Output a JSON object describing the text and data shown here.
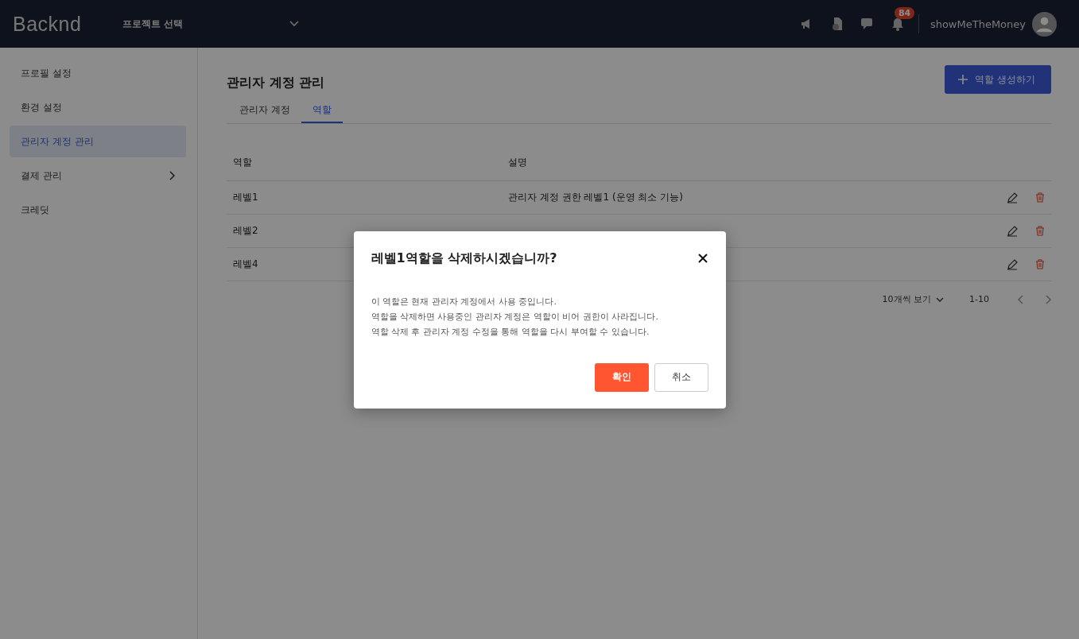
{
  "header": {
    "logo": "Backnd",
    "project_select": {
      "label": "프로젝트 선택"
    },
    "notification_count": "84",
    "username": "showMeTheMoney"
  },
  "sidebar": {
    "items": [
      {
        "label": "프로필 설정",
        "selected": false,
        "expandable": false
      },
      {
        "label": "환경 설정",
        "selected": false,
        "expandable": false
      },
      {
        "label": "관리자 계정 관리",
        "selected": true,
        "expandable": false
      },
      {
        "label": "결제 관리",
        "selected": false,
        "expandable": true
      },
      {
        "label": "크레딧",
        "selected": false,
        "expandable": false
      }
    ]
  },
  "page": {
    "title": "관리자 계정 관리",
    "create_button": "역할 생성하기",
    "tabs": [
      {
        "label": "관리자 계정",
        "selected": false
      },
      {
        "label": "역할",
        "selected": true
      }
    ],
    "table": {
      "columns": [
        "역할",
        "설명"
      ],
      "rows": [
        {
          "role": "레벨1",
          "description": "관리자 계정 권한 레벨1 (운영 최소 기능)"
        },
        {
          "role": "레벨2"
        },
        {
          "role": "레벨4"
        }
      ]
    },
    "pagination": {
      "page_size": "10개씩 보기",
      "range": "1-10"
    }
  },
  "dialog": {
    "title": "레벨1역할을 삭제하시겠습니까?",
    "lines": [
      "이 역할은 현재 관리자 계정에서 사용 중입니다.",
      "역할을 삭제하면 사용중인 관리자 계정은 역할이 비어 권한이 사라집니다.",
      "역할 삭제 후 관리자 계정 수정을 통해 역할을 다시 부여할 수 있습니다."
    ],
    "confirm": "확인",
    "cancel": "취소"
  }
}
